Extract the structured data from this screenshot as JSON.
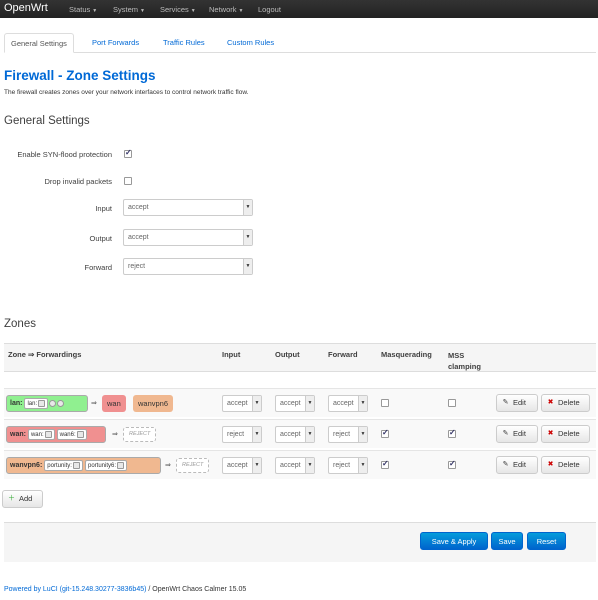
{
  "brand": "OpenWrt",
  "nav": [
    {
      "label": "Status"
    },
    {
      "label": "System"
    },
    {
      "label": "Services"
    },
    {
      "label": "Network"
    },
    {
      "label": "Logout"
    }
  ],
  "tabs": [
    "General Settings",
    "Port Forwards",
    "Traffic Rules",
    "Custom Rules"
  ],
  "title": "Firewall - Zone Settings",
  "description": "The firewall creates zones over your network interfaces to control network traffic flow.",
  "general": {
    "heading": "General Settings",
    "syn_label": "Enable SYN-flood protection",
    "syn_checked": true,
    "drop_label": "Drop invalid packets",
    "drop_checked": false,
    "input_label": "Input",
    "input_value": "accept",
    "output_label": "Output",
    "output_value": "accept",
    "forward_label": "Forward",
    "forward_value": "reject"
  },
  "zones": {
    "heading": "Zones",
    "headers": {
      "zone": "Zone ⇒ Forwardings",
      "input": "Input",
      "output": "Output",
      "forward": "Forward",
      "masq": "Masquerading",
      "mss": "MSS clamping"
    },
    "rows": [
      {
        "name": "lan:",
        "ifaces": [
          "lan:"
        ],
        "color": "#90f090",
        "targets": [
          "wan",
          "wanvpn6"
        ],
        "input": "accept",
        "output": "accept",
        "forward": "accept",
        "masq": false,
        "mss": false
      },
      {
        "name": "wan:",
        "ifaces": [
          "wan:",
          "wan6:"
        ],
        "color": "#f09090",
        "targets": [],
        "reject": "REJECT",
        "input": "reject",
        "output": "accept",
        "forward": "reject",
        "masq": true,
        "mss": true
      },
      {
        "name": "wanvpn6:",
        "ifaces": [
          "portunity:",
          "portunity6:"
        ],
        "color": "#f0b890",
        "targets": [],
        "reject": "REJECT",
        "input": "accept",
        "output": "accept",
        "forward": "reject",
        "masq": true,
        "mss": true
      }
    ],
    "edit_label": "Edit",
    "delete_label": "Delete",
    "add_label": "Add"
  },
  "actions": {
    "save_apply": "Save & Apply",
    "save": "Save",
    "reset": "Reset"
  },
  "footer": {
    "link": "Powered by LuCI (git-15.248.30277-3836b45)",
    "text": " / OpenWrt Chaos Calmer 15.05"
  }
}
